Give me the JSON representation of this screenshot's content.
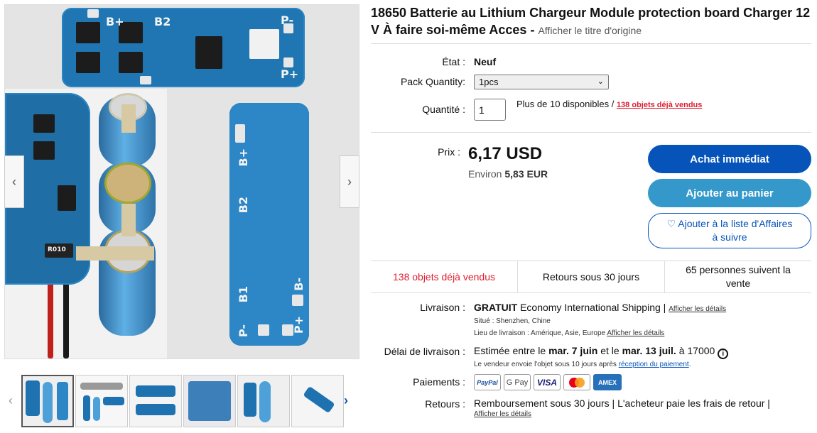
{
  "listing": {
    "title": "18650 Batterie au Lithium Chargeur Module protection board Charger 12 V À faire soi-même Acces -",
    "original_title_link": "Afficher le titre d'origine"
  },
  "details": {
    "condition_label": "État :",
    "condition_value": "Neuf",
    "pack_label": "Pack Quantity:",
    "pack_selected": "1pcs",
    "quantity_label": "Quantité :",
    "quantity_value": "1",
    "availability": "Plus de 10 disponibles /",
    "sold_link": "138 objets déjà vendus"
  },
  "pricing": {
    "price_label": "Prix :",
    "price": "6,17 USD",
    "approx_prefix": "Environ",
    "approx_value": "5,83 EUR"
  },
  "actions": {
    "buy_now": "Achat immédiat",
    "add_to_cart": "Ajouter au panier",
    "watchlist": "Ajouter à la liste d'Affaires à suivre"
  },
  "stats": {
    "sold": "138 objets déjà vendus",
    "returns": "Retours sous 30 jours",
    "watchers": "65 personnes suivent la vente"
  },
  "shipping": {
    "label": "Livraison :",
    "free": "GRATUIT",
    "method": "Economy International Shipping |",
    "details_link": "Afficher les détails",
    "location": "Situé : Shenzhen, Chine",
    "ship_to": "Lieu de livraison : Amérique, Asie, Europe",
    "ship_to_link": "Afficher les détails"
  },
  "delivery": {
    "label": "Délai de livraison :",
    "estimate_prefix": "Estimée entre le",
    "date_from": "mar. 7 juin",
    "between": "et le",
    "date_to": "mar. 13 juil.",
    "to_zip": "à 17000",
    "note": "Le vendeur envoie l'objet sous 10 jours après",
    "note_link": "réception du paiement",
    "note_end": "."
  },
  "payments": {
    "label": "Paiements :",
    "methods": [
      "PayPal",
      "G Pay",
      "VISA",
      "Mastercard",
      "AMEX"
    ]
  },
  "returns": {
    "label": "Retours :",
    "text": "Remboursement sous 30 jours | L'acheteur paie les frais de retour |",
    "link": "Afficher les détails"
  },
  "gallery": {
    "silk_labels": [
      "B+",
      "B2",
      "P-",
      "P+",
      "B-",
      "B1",
      "R010"
    ],
    "thumbnail_count": 6,
    "active_thumbnail": 1
  },
  "colors": {
    "brand_blue": "#0654ba",
    "cart_blue": "#3498ca",
    "sold_red": "#dd1e31",
    "pcb_blue": "#1f76b2"
  }
}
